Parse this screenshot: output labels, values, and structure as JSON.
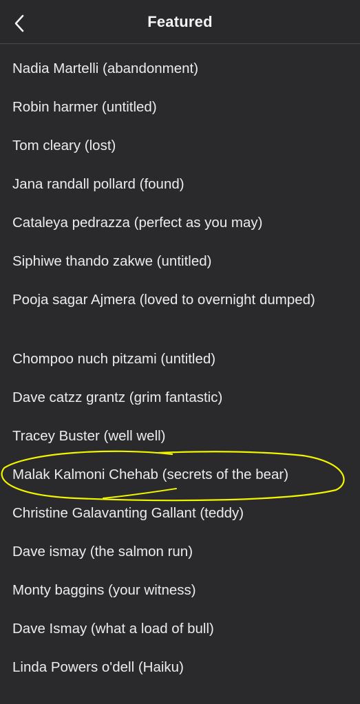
{
  "header": {
    "title": "Featured",
    "back_icon": "chevron-left-icon"
  },
  "items": [
    "Nadia Martelli (abandonment)",
    "Robin harmer (untitled)",
    "Tom cleary (lost)",
    "Jana randall pollard (found)",
    "Cataleya pedrazza (perfect as you may)",
    "Siphiwe thando zakwe (untitled)",
    "Pooja sagar Ajmera (loved to overnight dumped)",
    "Chompoo nuch pitzami (untitled)",
    "Dave catzz grantz (grim fantastic)",
    "Tracey Buster (well well)",
    "Malak Kalmoni Chehab (secrets of the bear)",
    "Christine Galavanting Gallant (teddy)",
    "Dave ismay (the salmon run)",
    "Monty baggins (your witness)",
    "Dave Ismay (what a load of bull)",
    "Linda Powers o'dell (Haiku)"
  ],
  "colors": {
    "background": "#2a2a2c",
    "text": "#ececec",
    "annotation": "#f2f500"
  }
}
